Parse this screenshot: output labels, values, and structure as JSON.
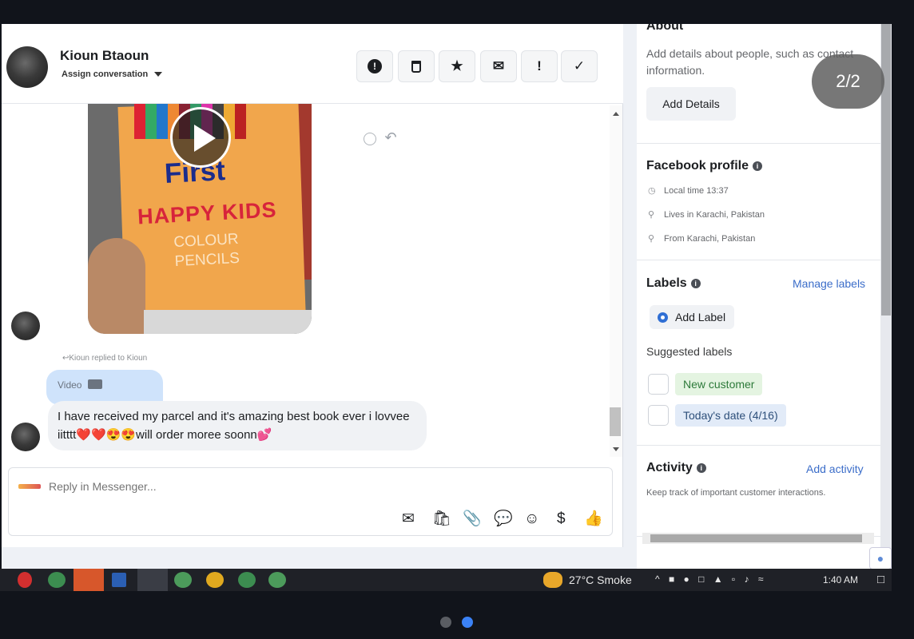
{
  "contact": {
    "name": "Kioun Btaoun",
    "assign_label": "Assign conversation"
  },
  "header_actions": [
    {
      "name": "report-button",
      "glyph": "!",
      "icon": "alert-circle-icon"
    },
    {
      "name": "delete-button",
      "glyph": "🗑",
      "icon": "trash-icon"
    },
    {
      "name": "star-button",
      "glyph": "★",
      "icon": "star-icon"
    },
    {
      "name": "mark-unread-button",
      "glyph": "✉",
      "icon": "envelope-icon"
    },
    {
      "name": "follow-up-button",
      "glyph": "!",
      "icon": "exclamation-icon"
    },
    {
      "name": "mark-done-button",
      "glyph": "✓",
      "icon": "check-icon"
    }
  ],
  "video_thumbnail": {
    "brand_first": "First",
    "brand_happy": "HAPPY KIDS",
    "brand_colour": "COLOUR",
    "brand_pencils": "PENCILS"
  },
  "conversation": {
    "reply_meta": "Kioun replied to Kioun",
    "quoted_label": "Video",
    "message": "I have received my parcel and it's amazing best book ever i lovvee iitttt❤️❤️😍😍will order moree soonn💕"
  },
  "composer": {
    "placeholder": "Reply in Messenger..."
  },
  "side_panel": {
    "about": {
      "title": "About",
      "description": "Add details about people, such as contact information.",
      "button": "Add Details"
    },
    "facebook_profile": {
      "title": "Facebook profile",
      "local_time": "Local time 13:37",
      "lives_in": "Lives in Karachi, Pakistan",
      "from": "From Karachi, Pakistan"
    },
    "labels": {
      "title": "Labels",
      "manage_link": "Manage labels",
      "add_button": "Add Label",
      "suggested_title": "Suggested labels",
      "suggested": [
        {
          "text": "New customer",
          "bg": "#e4f4e1",
          "color": "#2d7a3a"
        },
        {
          "text": "Today's date (4/16)",
          "bg": "#e2ebf8",
          "color": "#2d4f7a"
        }
      ]
    },
    "activity": {
      "title": "Activity",
      "add_link": "Add activity",
      "description": "Keep track of important customer interactions."
    }
  },
  "overlay": {
    "page_counter": "2/2"
  },
  "taskbar": {
    "weather": "27°C  Smoke",
    "time": "1:40 AM"
  },
  "colors": {
    "link_blue": "#3b6dc9",
    "pager_active": "#3b82f6",
    "pager_inactive": "#5a5d63"
  }
}
